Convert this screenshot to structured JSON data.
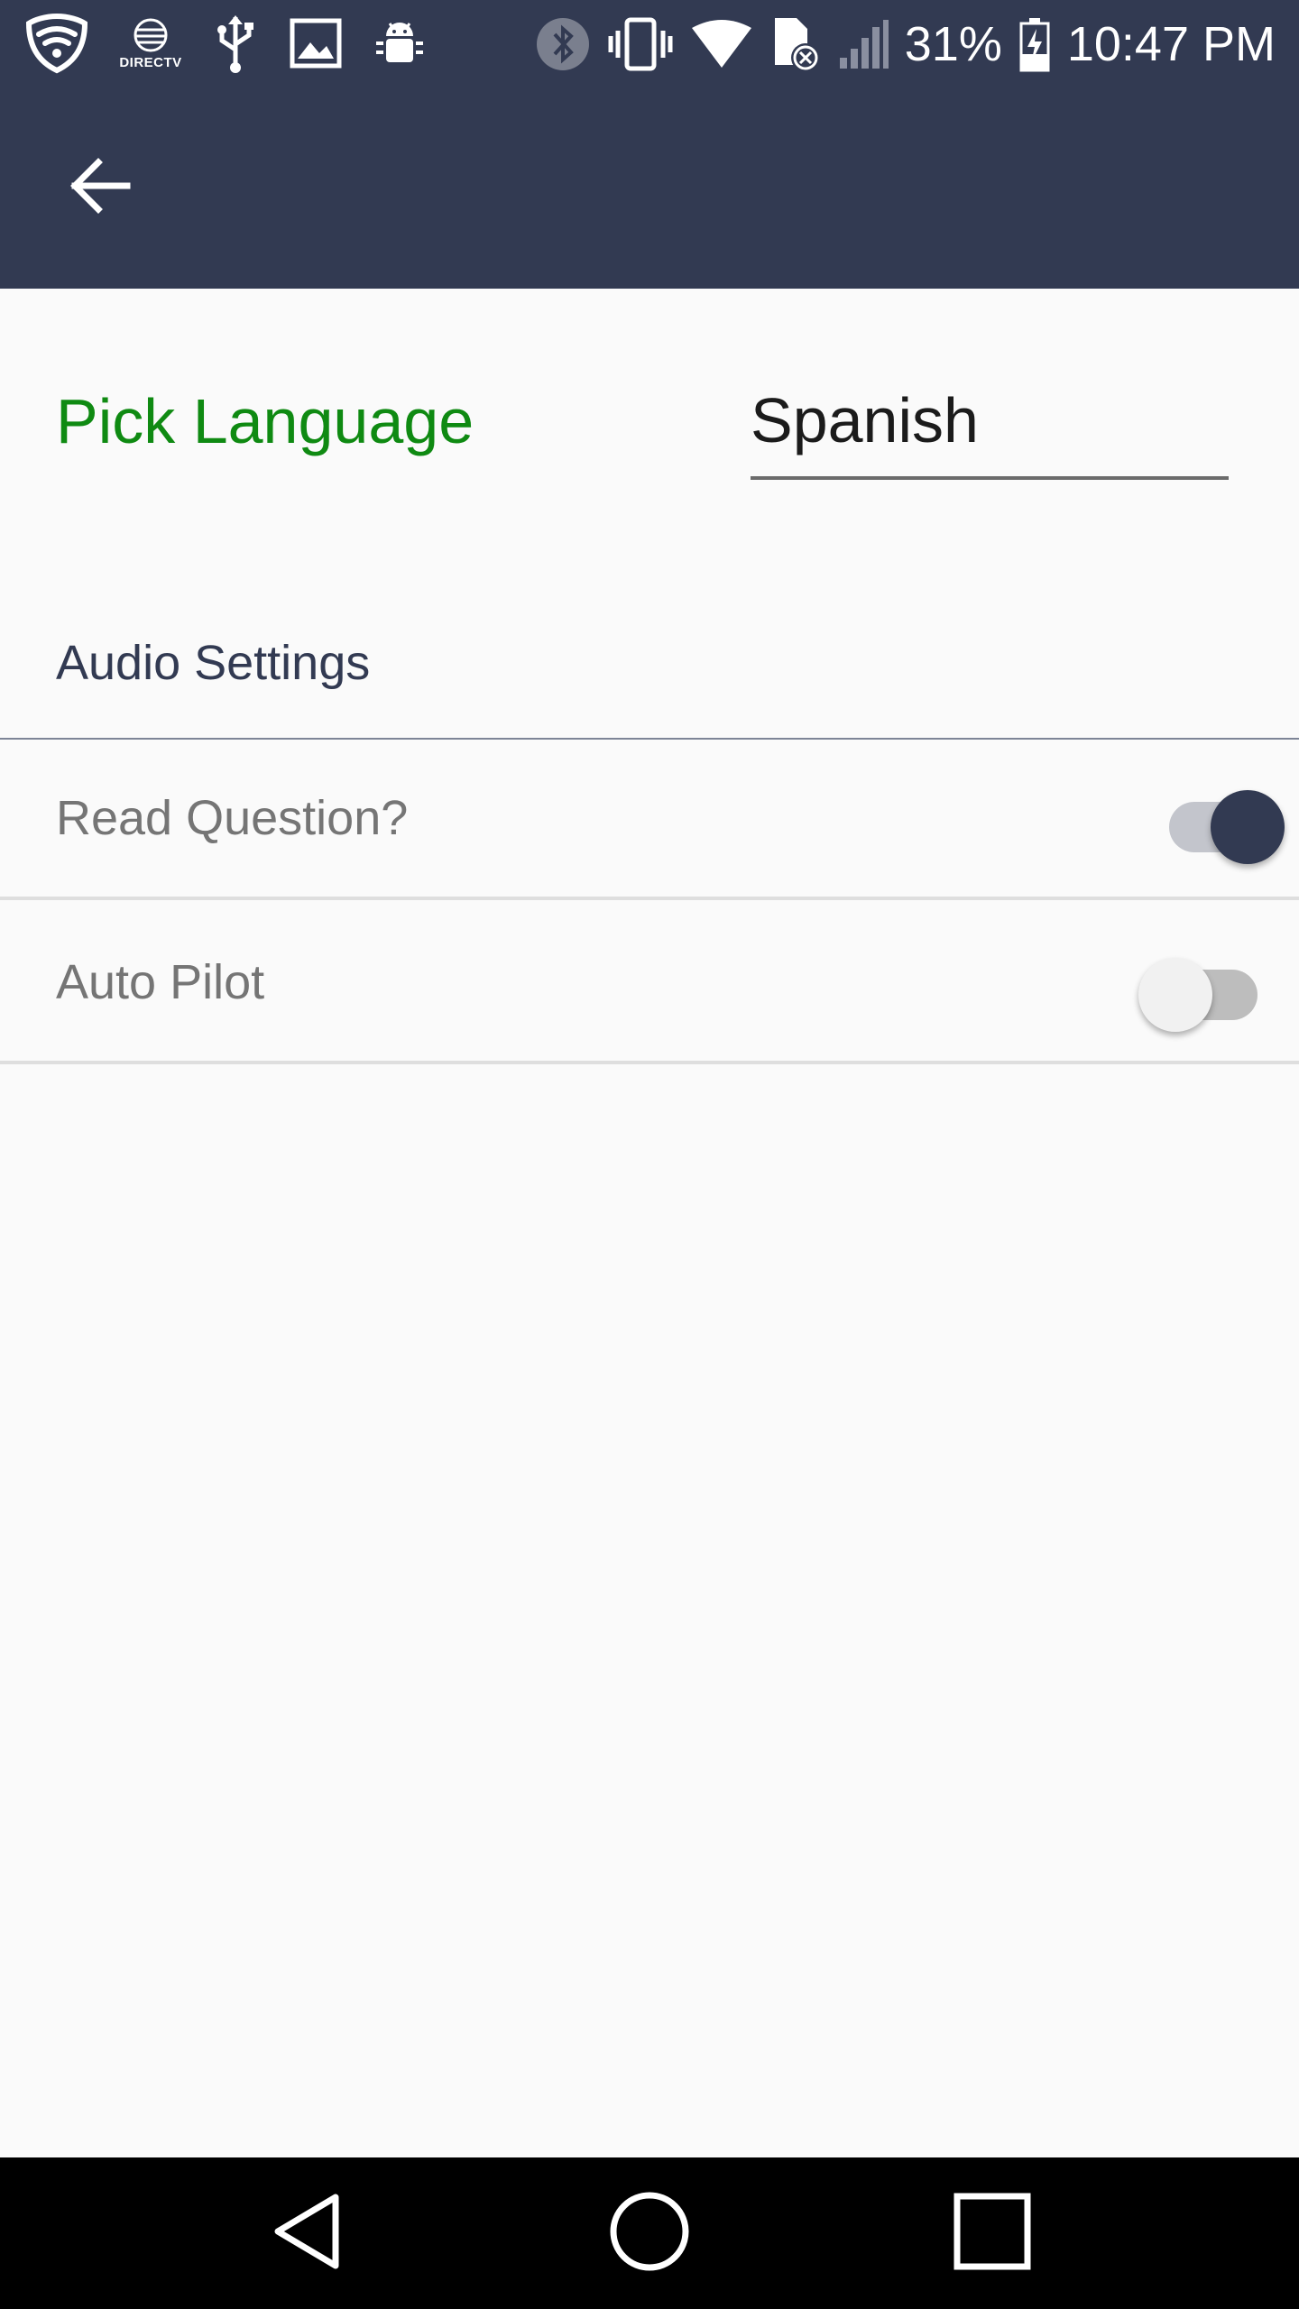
{
  "status_bar": {
    "icons_left": [
      "vpn-shield-icon",
      "directv-icon",
      "usb-icon",
      "image-icon",
      "android-debug-icon"
    ],
    "directv_label": "DIRECTV",
    "icons_right": [
      "bluetooth-icon",
      "vibrate-icon",
      "wifi-icon",
      "sim-error-icon",
      "cell-signal-icon",
      "battery-charging-icon"
    ],
    "battery_percent": "31%",
    "time": "10:47 PM"
  },
  "app_bar": {
    "back_icon": "arrow-left-icon"
  },
  "language": {
    "label": "Pick Language",
    "selected": "Spanish"
  },
  "audio_settings": {
    "header": "Audio Settings",
    "items": [
      {
        "label": "Read Question?",
        "enabled": true
      },
      {
        "label": "Auto Pilot",
        "enabled": false
      }
    ]
  },
  "nav_bar": {
    "buttons": [
      "back-triangle-icon",
      "home-circle-icon",
      "recents-square-icon"
    ]
  },
  "colors": {
    "primary": "#323a52",
    "accent_green": "#0f8a12",
    "background": "#fafafa",
    "secondary_text": "#757575"
  }
}
